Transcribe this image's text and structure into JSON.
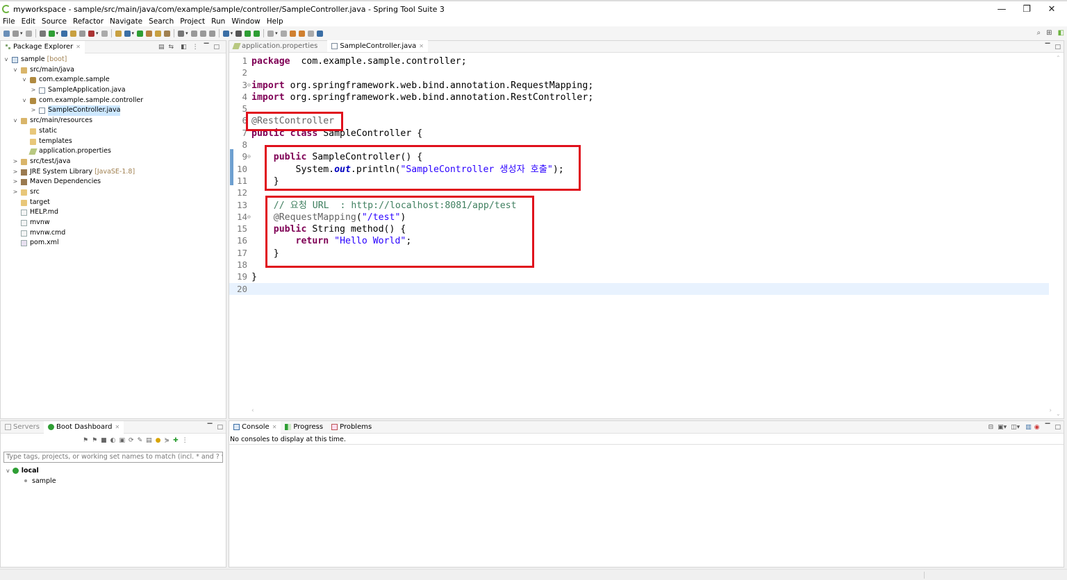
{
  "window": {
    "title": "myworkspace - sample/src/main/java/com/example/sample/controller/SampleController.java - Spring Tool Suite 3",
    "minimize": "—",
    "restore": "❐",
    "close": "✕"
  },
  "menu": [
    "File",
    "Edit",
    "Source",
    "Refactor",
    "Navigate",
    "Search",
    "Project",
    "Run",
    "Window",
    "Help"
  ],
  "package_explorer": {
    "tab_label": "Package Explorer",
    "tree": [
      {
        "label": "sample",
        "decoration": "[boot]",
        "depth": 0,
        "twisty": "v",
        "icon": "project-icon"
      },
      {
        "label": "src/main/java",
        "depth": 1,
        "twisty": "v",
        "icon": "source-folder-icon"
      },
      {
        "label": "com.example.sample",
        "depth": 2,
        "twisty": "v",
        "icon": "package-icon"
      },
      {
        "label": "SampleApplication.java",
        "depth": 3,
        "twisty": ">",
        "icon": "java-file-icon"
      },
      {
        "label": "com.example.sample.controller",
        "depth": 2,
        "twisty": "v",
        "icon": "package-icon"
      },
      {
        "label": "SampleController.java",
        "depth": 3,
        "twisty": ">",
        "icon": "java-file-icon",
        "selected": true
      },
      {
        "label": "src/main/resources",
        "depth": 1,
        "twisty": "v",
        "icon": "source-folder-icon"
      },
      {
        "label": "static",
        "depth": 2,
        "twisty": "",
        "icon": "folder-icon"
      },
      {
        "label": "templates",
        "depth": 2,
        "twisty": "",
        "icon": "folder-icon"
      },
      {
        "label": "application.properties",
        "depth": 2,
        "twisty": "",
        "icon": "properties-file-icon"
      },
      {
        "label": "src/test/java",
        "depth": 1,
        "twisty": ">",
        "icon": "source-folder-icon"
      },
      {
        "label": "JRE System Library",
        "decoration": "[JavaSE-1.8]",
        "depth": 1,
        "twisty": ">",
        "icon": "library-icon"
      },
      {
        "label": "Maven Dependencies",
        "depth": 1,
        "twisty": ">",
        "icon": "library-icon"
      },
      {
        "label": "src",
        "depth": 1,
        "twisty": ">",
        "icon": "folder-icon"
      },
      {
        "label": "target",
        "depth": 1,
        "twisty": "",
        "icon": "folder-icon"
      },
      {
        "label": "HELP.md",
        "depth": 1,
        "twisty": "",
        "icon": "text-file-icon"
      },
      {
        "label": "mvnw",
        "depth": 1,
        "twisty": "",
        "icon": "text-file-icon"
      },
      {
        "label": "mvnw.cmd",
        "depth": 1,
        "twisty": "",
        "icon": "text-file-icon"
      },
      {
        "label": "pom.xml",
        "depth": 1,
        "twisty": "",
        "icon": "maven-file-icon"
      }
    ]
  },
  "editor": {
    "tabs": [
      {
        "label": "application.properties",
        "active": false
      },
      {
        "label": "SampleController.java",
        "active": true
      }
    ],
    "lines": [
      {
        "n": "1",
        "tokens": [
          [
            "kw",
            "package"
          ],
          [
            "",
            "  com.example.sample.controller;"
          ]
        ]
      },
      {
        "n": "2",
        "tokens": []
      },
      {
        "n": "3",
        "fold": true,
        "tokens": [
          [
            "kw",
            "import"
          ],
          [
            "",
            " org.springframework.web.bind.annotation.RequestMapping;"
          ]
        ]
      },
      {
        "n": "4",
        "tokens": [
          [
            "kw",
            "import"
          ],
          [
            "",
            " org.springframework.web.bind.annotation.RestController;"
          ]
        ]
      },
      {
        "n": "5",
        "tokens": []
      },
      {
        "n": "6",
        "tokens": [
          [
            "an",
            "@RestController"
          ]
        ]
      },
      {
        "n": "7",
        "tokens": [
          [
            "kw",
            "public"
          ],
          [
            "",
            " "
          ],
          [
            "kw",
            "class"
          ],
          [
            "",
            " SampleController {"
          ]
        ]
      },
      {
        "n": "8",
        "tokens": []
      },
      {
        "n": "9",
        "fold": true,
        "tokens": [
          [
            "",
            "    "
          ],
          [
            "kw",
            "public"
          ],
          [
            "",
            " SampleController() {"
          ]
        ]
      },
      {
        "n": "10",
        "tokens": [
          [
            "",
            "        System."
          ],
          [
            "fi",
            "out"
          ],
          [
            "",
            ".println("
          ],
          [
            "st",
            "\"SampleController 생성자 호출\""
          ],
          [
            "",
            ");"
          ]
        ]
      },
      {
        "n": "11",
        "tokens": [
          [
            "",
            "    }"
          ]
        ]
      },
      {
        "n": "12",
        "tokens": []
      },
      {
        "n": "13",
        "tokens": [
          [
            "",
            "    "
          ],
          [
            "cm",
            "// 요청 URL  : http://localhost:8081/app/test"
          ]
        ]
      },
      {
        "n": "14",
        "fold": true,
        "tokens": [
          [
            "",
            "    "
          ],
          [
            "an",
            "@RequestMapping"
          ],
          [
            "",
            "("
          ],
          [
            "st",
            "\"/test\""
          ],
          [
            "",
            ")"
          ]
        ]
      },
      {
        "n": "15",
        "tokens": [
          [
            "",
            "    "
          ],
          [
            "kw",
            "public"
          ],
          [
            "",
            " String method() {"
          ]
        ]
      },
      {
        "n": "16",
        "tokens": [
          [
            "",
            "        "
          ],
          [
            "kw",
            "return"
          ],
          [
            "",
            " "
          ],
          [
            "st",
            "\"Hello World\""
          ],
          [
            "",
            ";"
          ]
        ]
      },
      {
        "n": "17",
        "tokens": [
          [
            "",
            "    }"
          ]
        ]
      },
      {
        "n": "18",
        "tokens": []
      },
      {
        "n": "19",
        "tokens": [
          [
            "",
            "}"
          ]
        ]
      },
      {
        "n": "20",
        "tokens": [],
        "current": true
      }
    ]
  },
  "boot_dashboard": {
    "servers_tab": "Servers",
    "dashboard_tab": "Boot Dashboard",
    "filter_placeholder": "Type tags, projects, or working set names to match (incl. * and ? wildcards)",
    "local_label": "local",
    "app_label": "sample"
  },
  "console": {
    "tabs": [
      "Console",
      "Progress",
      "Problems"
    ],
    "message": "No consoles to display at this time."
  },
  "colors": {
    "keyword": "#7f0055",
    "annotation": "#646464",
    "string": "#2a00ff",
    "comment": "#3f7f5f",
    "highlight_box": "#e0101c",
    "boot_green": "#2e9e34"
  }
}
